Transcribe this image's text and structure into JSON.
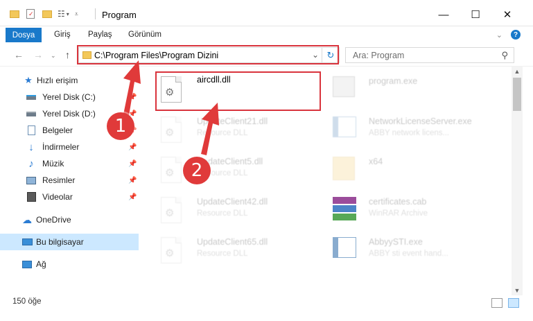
{
  "window": {
    "title": "Program",
    "controls": {
      "minimize": "—",
      "maximize": "☐",
      "close": "✕"
    }
  },
  "ribbon": {
    "tabs": [
      "Dosya",
      "Giriş",
      "Paylaş",
      "Görünüm"
    ],
    "expand_icon": "chevron-down-icon",
    "help_label": "?"
  },
  "navigation": {
    "address": "C:\\Program Files\\Program Dizini",
    "search_placeholder": "Ara: Program"
  },
  "sidebar": {
    "items": [
      {
        "label": "Hızlı erişim",
        "icon": "star-icon",
        "pinned": false
      },
      {
        "label": "Yerel Disk (C:)",
        "icon": "drive-icon",
        "pinned": true
      },
      {
        "label": "Yerel Disk (D:)",
        "icon": "drive-icon",
        "pinned": true
      },
      {
        "label": "Belgeler",
        "icon": "document-icon",
        "pinned": true
      },
      {
        "label": "İndirmeler",
        "icon": "download-icon",
        "pinned": true
      },
      {
        "label": "Müzik",
        "icon": "music-icon",
        "pinned": true
      },
      {
        "label": "Resimler",
        "icon": "pictures-icon",
        "pinned": true
      },
      {
        "label": "Videolar",
        "icon": "video-icon",
        "pinned": true
      },
      {
        "label": "OneDrive",
        "icon": "cloud-icon",
        "pinned": false
      },
      {
        "label": "Bu bilgisayar",
        "icon": "computer-icon",
        "pinned": false,
        "selected": true
      },
      {
        "label": "Ağ",
        "icon": "network-icon",
        "pinned": false
      }
    ]
  },
  "files": [
    {
      "name": "aircdll.dll",
      "desc": "",
      "type": "dll",
      "highlighted": true
    },
    {
      "name": "program.exe",
      "desc": "",
      "type": "exe"
    },
    {
      "name": "UpdateClient21.dll",
      "desc": "Resource DLL",
      "type": "dll"
    },
    {
      "name": "NetworkLicenseServer.exe",
      "desc": "ABBY network licens...",
      "type": "exe"
    },
    {
      "name": "UpdateClient5.dll",
      "desc": "Resource DLL",
      "type": "dll"
    },
    {
      "name": "x64",
      "desc": "",
      "type": "folder"
    },
    {
      "name": "UpdateClient42.dll",
      "desc": "Resource DLL",
      "type": "dll"
    },
    {
      "name": "certificates.cab",
      "desc": "WinRAR Archive",
      "type": "archive"
    },
    {
      "name": "UpdateClient65.dll",
      "desc": "Resource DLL",
      "type": "dll"
    },
    {
      "name": "AbbyySTI.exe",
      "desc": "ABBY sti event hand...",
      "type": "exe"
    }
  ],
  "status": {
    "count": "150 öğe"
  },
  "annotations": {
    "marker1": "1",
    "marker2": "2",
    "color": "#d9333c"
  }
}
